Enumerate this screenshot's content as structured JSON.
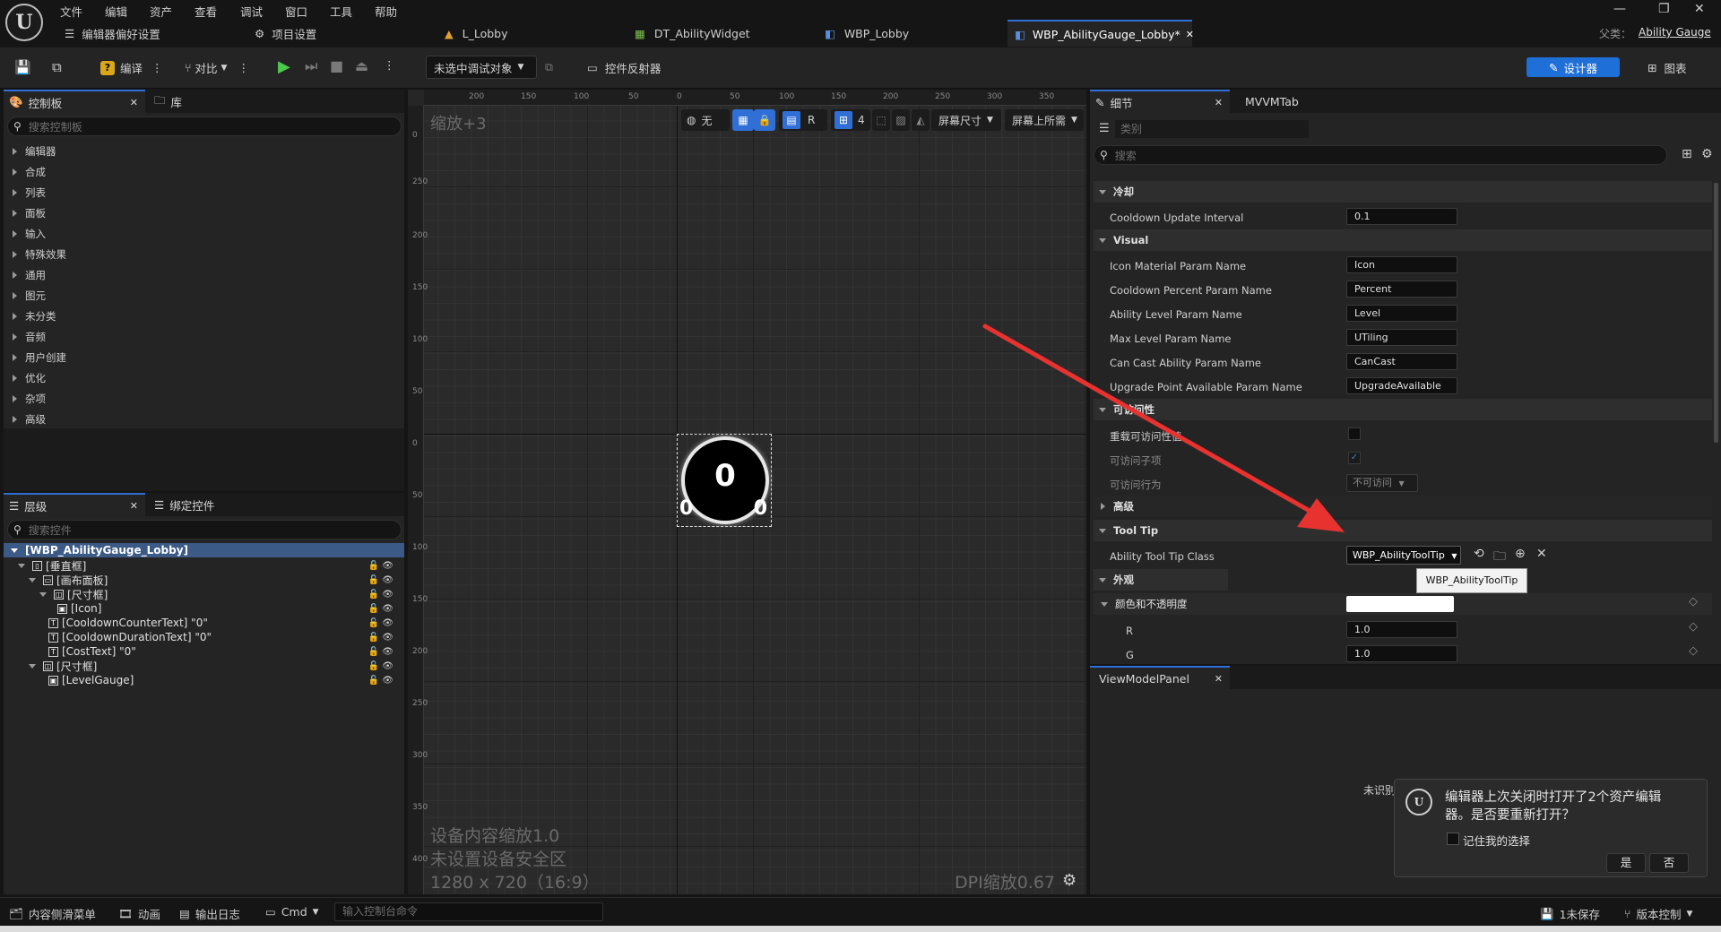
{
  "menu": [
    "文件",
    "编辑",
    "资产",
    "查看",
    "调试",
    "窗口",
    "工具",
    "帮助"
  ],
  "tabs": {
    "editor_prefs": "编辑器偏好设置",
    "project_settings": "项目设置",
    "t1": "L_Lobby",
    "t2": "DT_AbilityWidget",
    "t3": "WBP_Lobby",
    "t4": "WBP_AbilityGauge_Lobby*",
    "parent_label": "父类：",
    "parent_value": "Ability Gauge"
  },
  "toolbar": {
    "compile": "编译",
    "diff": "对比",
    "debug_target": "未选中调试对象",
    "widget_reflector": "控件反射器",
    "designer": "设计器",
    "graph": "图表"
  },
  "palette": {
    "tab_palette": "控制板",
    "tab_library": "库",
    "search_placeholder": "搜索控制板",
    "categories": [
      "编辑器",
      "合成",
      "列表",
      "面板",
      "输入",
      "特殊效果",
      "通用",
      "图元",
      "未分类",
      "音频",
      "用户创建",
      "优化",
      "杂项",
      "高级"
    ]
  },
  "hierarchy": {
    "tab_hierarchy": "层级",
    "tab_bind": "绑定控件",
    "search_placeholder": "搜索控件",
    "root": "[WBP_AbilityGauge_Lobby]",
    "items": [
      {
        "label": "[垂直框]",
        "icon": "▯"
      },
      {
        "label": "[画布面板]",
        "icon": "▭"
      },
      {
        "label": "[尺寸框]",
        "icon": "◫"
      },
      {
        "label": "[Icon]",
        "icon": "▣"
      },
      {
        "label": "[CooldownCounterText] \"0\"",
        "icon": "T"
      },
      {
        "label": "[CooldownDurationText] \"0\"",
        "icon": "T"
      },
      {
        "label": "[CostText] \"0\"",
        "icon": "T"
      },
      {
        "label": "[尺寸框]",
        "icon": "◫"
      },
      {
        "label": "[LevelGauge]",
        "icon": "▣"
      }
    ]
  },
  "canvas": {
    "zoom": "缩放+3",
    "tool_none": "无",
    "tool_r": "R",
    "tool_grid": "4",
    "screen_size": "屏幕尺寸",
    "screen_fill": "屏幕上所需",
    "gauge_center": "0",
    "gauge_left": "0",
    "gauge_right": "0",
    "ruler_top": [
      "200",
      "150",
      "100",
      "50",
      "0",
      "50",
      "100",
      "150",
      "200",
      "250",
      "300",
      "350"
    ],
    "ruler_left": [
      "0",
      "250",
      "200",
      "150",
      "100",
      "50",
      "0",
      "50",
      "100",
      "150",
      "200",
      "250",
      "300",
      "350",
      "400"
    ],
    "overlay_line1": "设备内容缩放1.0",
    "overlay_line2": "未设置设备安全区",
    "overlay_line3": "1280 x 720（16:9）",
    "dpi": "DPI缩放0.67"
  },
  "details": {
    "tab_details": "细节",
    "tab_mvvm": "MVVMTab",
    "category_placeholder": "类别",
    "search_placeholder": "搜索",
    "sections": {
      "cooldown": "冷却",
      "visual": "Visual",
      "accessibility": "可访问性",
      "advanced": "高级",
      "tooltip": "Tool Tip",
      "appearance": "外观",
      "color": "颜色和不透明度"
    },
    "props": {
      "cooldown_interval": {
        "label": "Cooldown Update Interval",
        "value": "0.1"
      },
      "icon_mat": {
        "label": "Icon Material Param Name",
        "value": "Icon"
      },
      "cooldown_pct": {
        "label": "Cooldown Percent Param Name",
        "value": "Percent"
      },
      "ability_level": {
        "label": "Ability Level Param Name",
        "value": "Level"
      },
      "max_level": {
        "label": "Max Level Param Name",
        "value": "UTiling"
      },
      "can_cast": {
        "label": "Can Cast Ability Param Name",
        "value": "CanCast"
      },
      "upgrade_point": {
        "label": "Upgrade Point Available Param Name",
        "value": "UpgradeAvailable"
      },
      "override_access": {
        "label": "重载可访问性值"
      },
      "accessible_children": {
        "label": "可访问子项"
      },
      "access_behavior": {
        "label": "可访问行为",
        "value": "不可访问"
      },
      "tooltip_class": {
        "label": "Ability Tool Tip Class",
        "value": "WBP_AbilityToolTip"
      },
      "color_r": {
        "label": "R",
        "value": "1.0"
      },
      "color_g": {
        "label": "G",
        "value": "1.0"
      }
    },
    "tooltip_popup": "WBP_AbilityToolTip"
  },
  "viewmodel": {
    "tab": "ViewModelPanel",
    "partial_text": "未识别"
  },
  "dialog": {
    "message_line1": "编辑器上次关闭时打开了2个资产编辑",
    "message_line2": "器。是否要重新打开？",
    "remember": "记住我的选择",
    "yes": "是",
    "no": "否"
  },
  "statusbar": {
    "content_drawer": "内容侧滑菜单",
    "animation": "动画",
    "output_log": "输出日志",
    "cmd": "Cmd",
    "console_placeholder": "输入控制台命令",
    "unsaved": "1未保存",
    "source_control": "版本控制"
  },
  "colors": {
    "accent": "#2f6fd6",
    "arrow": "#e8322f"
  }
}
